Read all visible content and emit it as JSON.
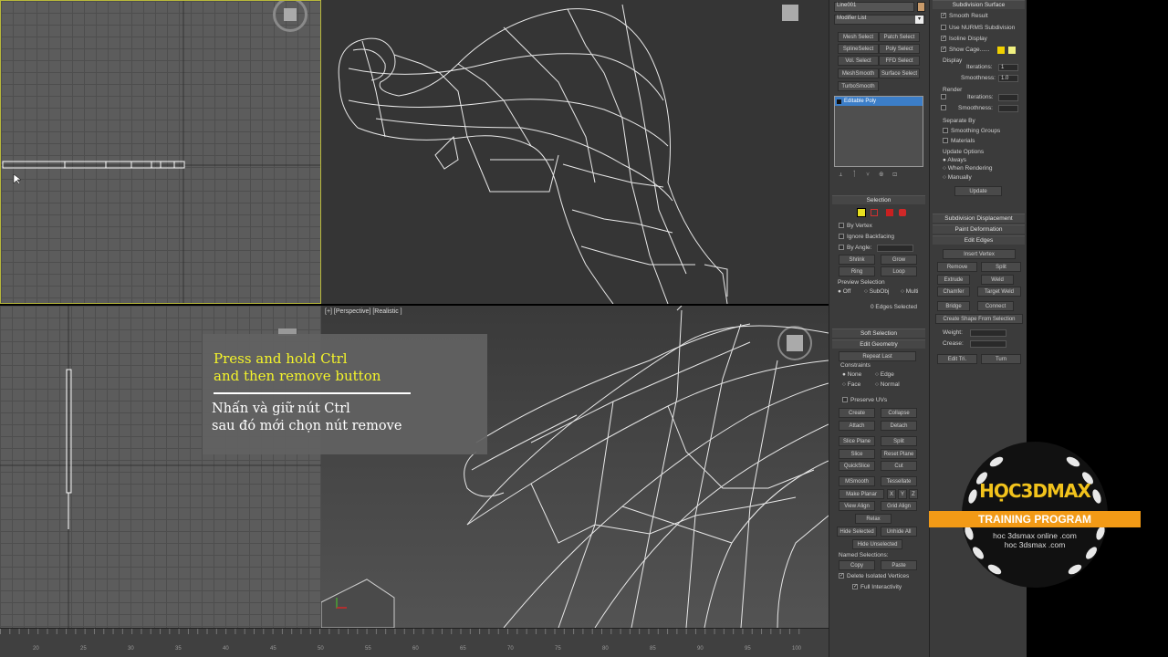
{
  "viewports": {
    "perspective_label": "[+] [Perspective] [Realistic ]"
  },
  "timeline": {
    "ticks": [
      "20",
      "25",
      "30",
      "35",
      "40",
      "45",
      "50",
      "55",
      "60",
      "65",
      "70",
      "75",
      "80",
      "85",
      "90",
      "95",
      "100"
    ]
  },
  "panel_left": {
    "object_name": "Line001",
    "modifier_list": "Modifier List",
    "buttons": [
      [
        "Mesh Select",
        "Patch Select"
      ],
      [
        "SplineSelect",
        "Poly Select"
      ],
      [
        "Vol. Select",
        "FFD Select"
      ],
      [
        "MeshSmooth",
        "Surface Select"
      ],
      [
        "TurboSmooth",
        ""
      ]
    ],
    "stack_item": "Editable Poly",
    "selection": {
      "title": "Selection",
      "by_vertex": "By Vertex",
      "ignore_backfacing": "Ignore Backfacing",
      "by_angle": "By Angle:",
      "shrink": "Shrink",
      "grow": "Grow",
      "ring": "Ring",
      "loop": "Loop",
      "preview_selection": "Preview Selection",
      "off": "Off",
      "subobj": "SubObj",
      "multi": "Multi",
      "status": "0 Edges Selected"
    },
    "soft_selection": "Soft Selection",
    "edit_geometry": {
      "title": "Edit Geometry",
      "repeat_last": "Repeat Last",
      "constraints": "Constraints",
      "none": "None",
      "edge": "Edge",
      "face": "Face",
      "normal": "Normal",
      "preserve_uvs": "Preserve UVs",
      "create": "Create",
      "collapse": "Collapse",
      "attach": "Attach",
      "detach": "Detach",
      "slice_plane": "Slice Plane",
      "split": "Split",
      "slice": "Slice",
      "reset_plane": "Reset Plane",
      "quickslice": "QuickSlice",
      "cut": "Cut",
      "msmooth": "MSmooth",
      "tessellate": "Tessellate",
      "make_planar": "Make Planar",
      "x": "X",
      "y": "Y",
      "z": "Z",
      "view_align": "View Align",
      "grid_align": "Grid Align",
      "relax": "Relax",
      "hide_selected": "Hide Selected",
      "unhide_all": "Unhide All",
      "hide_unselected": "Hide Unselected",
      "named_selections": "Named Selections:",
      "copy": "Copy",
      "paste": "Paste",
      "delete_isolated": "Delete Isolated Vertices",
      "full_interactivity": "Full Interactivity"
    }
  },
  "panel_right": {
    "subdivision_surface": "Subdivision Surface",
    "smooth_result": "Smooth Result",
    "use_nurms": "Use NURMS Subdivision",
    "isoline_display": "Isoline Display",
    "show_cage": "Show Cage......",
    "display": "Display",
    "iterations": "Iterations:",
    "iterations_value": "1",
    "smoothness": "Smoothness:",
    "smoothness_value": "1.0",
    "render": "Render",
    "render_iterations": "Iterations:",
    "render_smoothness": "Smoothness:",
    "separate_by": "Separate By",
    "smoothing_groups": "Smoothing Groups",
    "materials": "Materials",
    "update_options": "Update Options",
    "always": "Always",
    "when_rendering": "When Rendering",
    "manually": "Manually",
    "update": "Update",
    "subdivision_displacement": "Subdivision Displacement",
    "paint_deformation": "Paint Deformation",
    "edit_edges": {
      "title": "Edit Edges",
      "insert_vertex": "Insert Vertex",
      "remove": "Remove",
      "split": "Split",
      "extrude": "Extrude",
      "weld": "Weld",
      "chamfer": "Chamfer",
      "target_weld": "Target Weld",
      "bridge": "Bridge",
      "connect": "Connect",
      "create_shape": "Create Shape From Selection",
      "weight": "Weight:",
      "crease": "Crease:",
      "edit_tri": "Edit Tri.",
      "turn": "Turn"
    }
  },
  "caption": {
    "en_line1": "Press and hold Ctrl",
    "en_line2": "and then remove button",
    "vi_line1": "Nhấn và giữ nút Ctrl",
    "vi_line2": "sau đó mới chọn nút remove",
    "en_color": "#f4f42a"
  },
  "logo": {
    "title": "HỌC3DMAX",
    "ribbon": "TRAINING PROGRAM",
    "url1": "hoc 3dsmax online .com",
    "url2": "hoc 3dsmax .com",
    "accent": "#f29a16"
  }
}
